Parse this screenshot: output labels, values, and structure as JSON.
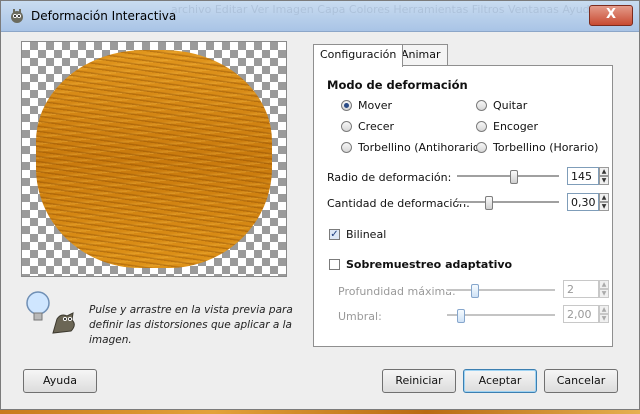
{
  "window": {
    "title": "Deformación Interactiva",
    "close_label": "X",
    "background_text": "archivo  Editar  Ver  Imagen  Capa  Colores  Herramientas  Filtros  Ventanas  Ayuda"
  },
  "hint": {
    "text": "Pulse y arrastre en la vista previa para definir las distorsiones que aplicar a la imagen."
  },
  "tabs": [
    {
      "label": "Configuración",
      "active": true
    },
    {
      "label": "Animar",
      "active": false
    }
  ],
  "mode": {
    "title": "Modo de deformación",
    "options": [
      {
        "label": "Mover",
        "checked": true
      },
      {
        "label": "Quitar",
        "checked": false
      },
      {
        "label": "Crecer",
        "checked": false
      },
      {
        "label": "Encoger",
        "checked": false
      },
      {
        "label": "Torbellino (Antihorario)",
        "checked": false
      },
      {
        "label": "Torbellino (Horario)",
        "checked": false
      }
    ]
  },
  "radius": {
    "label": "Radio de deformación:",
    "value": "145"
  },
  "amount": {
    "label": "Cantidad de deformación:",
    "value": "0,30"
  },
  "bilinear": {
    "label": "Bilineal",
    "checked": true
  },
  "supersample": {
    "label": "Sobremuestreo adaptativo",
    "checked": false,
    "depth_label": "Profundidad máxima:",
    "depth_value": "2",
    "threshold_label": "Umbral:",
    "threshold_value": "2,00"
  },
  "buttons": {
    "help": "Ayuda",
    "reset": "Reiniciar",
    "ok": "Aceptar",
    "cancel": "Cancelar"
  },
  "colors": {
    "titlebar": "#b7cfeb",
    "wood": "#d98a14",
    "accent": "#3c7fb1"
  }
}
